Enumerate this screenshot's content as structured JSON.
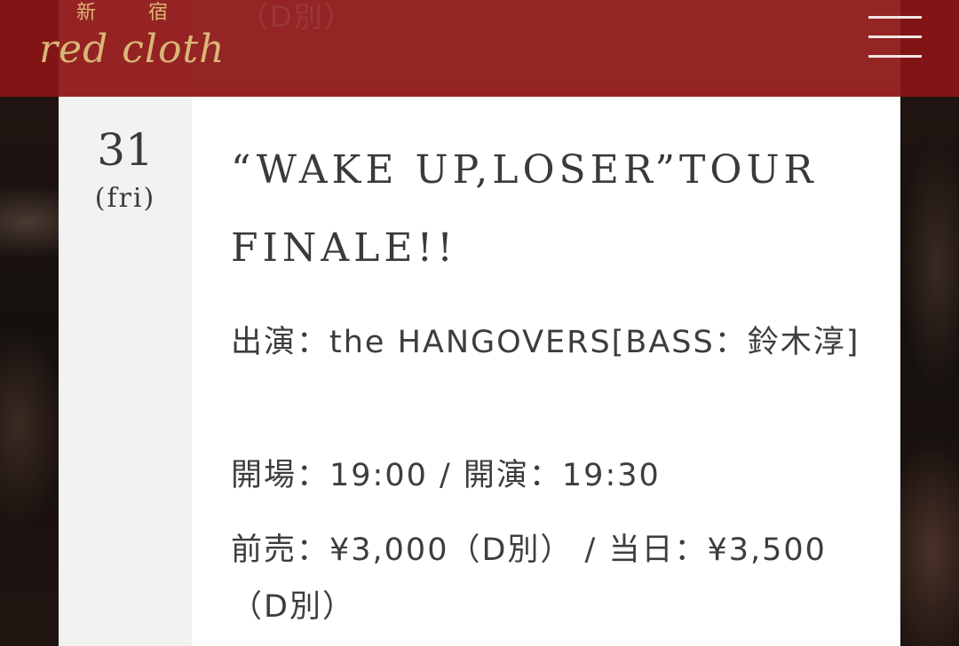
{
  "header": {
    "logo_kanji": "新 宿",
    "logo_text": "red cloth",
    "menu_icon": "hamburger-menu-icon"
  },
  "previous_event": {
    "price_tail": "（D別）"
  },
  "event": {
    "day": "31",
    "weekday": "(fri)",
    "title": "“WAKE UP,LOSER”TOUR FINALE!!",
    "performer": "出演：the HANGOVERS[BASS：鈴木淳]",
    "times": "開場：19:00 / 開演：19:30",
    "price": "前売：¥3,000（D別） / 当日：¥3,500（D別）"
  },
  "colors": {
    "header_bg": "#8e1616",
    "logo_gold": "#d9b777",
    "card_bg": "#ffffff",
    "date_col_bg": "#f3f2f1",
    "text": "#3a3a3a"
  }
}
